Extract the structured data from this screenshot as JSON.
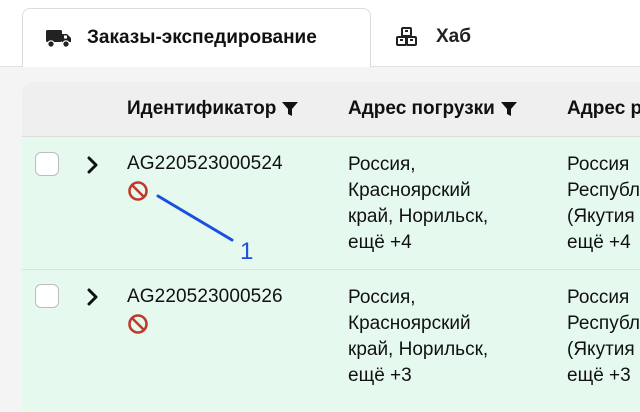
{
  "tabs": [
    {
      "label": "Заказы-экспедирование",
      "icon": "truck-icon",
      "active": true
    },
    {
      "label": "Хаб",
      "icon": "boxes-icon",
      "active": false
    }
  ],
  "table": {
    "columns": [
      {
        "label": "Идентификатор",
        "filter": true
      },
      {
        "label": "Адрес погрузки",
        "filter": true
      },
      {
        "label": "Адрес р"
      }
    ],
    "rows": [
      {
        "id": "AG220523000524",
        "status_icon": "forbidden-icon",
        "load_address": "Россия,\nКрасноярский\nкрай, Норильск,\nещё +4",
        "unload_address": "Россия\nРеспубл\n(Якутия\nещё +4"
      },
      {
        "id": "AG220523000526",
        "status_icon": "forbidden-icon",
        "load_address": "Россия,\nКрасноярский\nкрай, Норильск,\nещё +3",
        "unload_address": "Россия\nРеспубл\n(Якутия\nещё +3"
      }
    ]
  },
  "annotation": {
    "label": "1",
    "color": "#1b4fe0"
  },
  "colors": {
    "row_bg": "#e6f9ef",
    "header_bg": "#efefef",
    "forbidden": "#c0392b"
  }
}
